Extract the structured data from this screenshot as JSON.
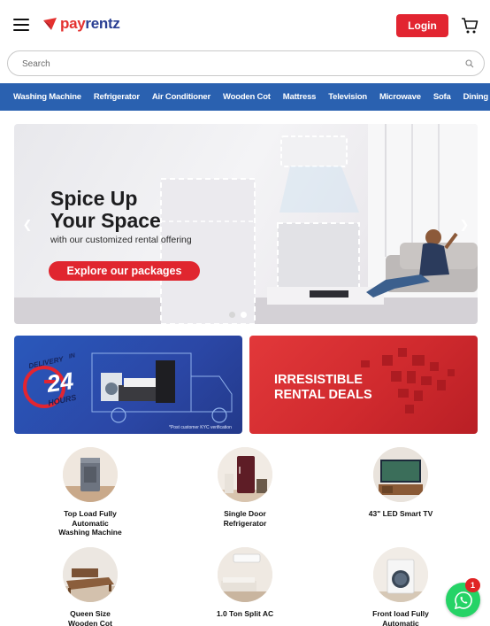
{
  "header": {
    "logo_pay": "pay",
    "logo_rentz": "rentz",
    "login_label": "Login"
  },
  "search": {
    "placeholder": "Search"
  },
  "categories": [
    "Washing Machine",
    "Refrigerator",
    "Air Conditioner",
    "Wooden Cot",
    "Mattress",
    "Television",
    "Microwave",
    "Sofa",
    "Dining Table"
  ],
  "hero": {
    "title": "Spice Up\nYour Space",
    "subtitle": "with our customized rental offering",
    "cta": "Explore our packages",
    "slides": 2,
    "active_slide": 2
  },
  "promos": {
    "delivery_top": "DELIVERY",
    "delivery_in": "IN",
    "delivery_hours_num": "24",
    "delivery_hours": "HOURS",
    "delivery_note": "*Post customer KYC verification",
    "deals_text": "IRRESISTIBLE\nRENTAL DEALS"
  },
  "products": [
    {
      "label": "Top Load Fully\nAutomatic\nWashing Machine",
      "icon": "washing-machine-top-load-icon"
    },
    {
      "label": "Single Door\nRefrigerator",
      "icon": "refrigerator-icon"
    },
    {
      "label": "43\" LED Smart TV",
      "icon": "tv-icon"
    },
    {
      "label": "Queen Size\nWooden Cot",
      "icon": "cot-icon"
    },
    {
      "label": "1.0 Ton Split AC",
      "icon": "ac-icon"
    },
    {
      "label": "Front load Fully\nAutomatic",
      "icon": "washing-machine-front-load-icon"
    }
  ],
  "whatsapp": {
    "badge": "1"
  },
  "colors": {
    "brand_red": "#e22531",
    "brand_blue": "#2a61b0",
    "logo_blue": "#2a3f93",
    "whatsapp_green": "#25d366"
  }
}
